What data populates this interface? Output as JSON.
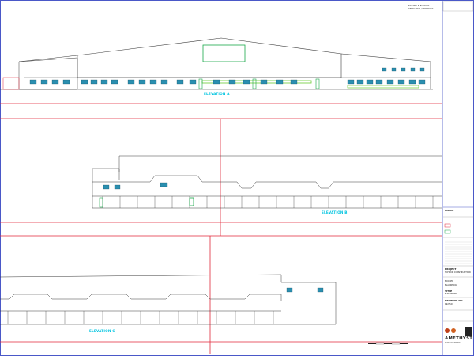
{
  "drawing": {
    "elevations": [
      {
        "id": "elevation-a",
        "label": "ELEVATION A"
      },
      {
        "id": "elevation-b",
        "label": "ELEVATION B"
      },
      {
        "id": "elevation-c",
        "label": "ELEVATION C"
      }
    ],
    "legend_notes": [
      "EXISTING ELEVATIONS",
      "DEMOLITION / NEW WORK"
    ],
    "colors": {
      "building_line": "#3a3a3a",
      "grid_red": "#e0283a",
      "window_fill": "#2a8fb0",
      "door_green": "#1aa84a",
      "highlight_green": "#7ad14a",
      "label_cyan": "#00c4e0",
      "border_blue": "#4a58c8"
    }
  },
  "title_block": {
    "client_label": "CLIENT",
    "project_label": "PROJECT",
    "project_line1": "SCHOOL CONSTRUCTION",
    "site_line1": "BOOKER",
    "site_line2": "BLACKPOOL",
    "drawing_title_label": "TITLE",
    "drawing_title": "ELEVATIONS",
    "drawing_no_label": "DRAWING NO.",
    "drawing_no": "1925-01",
    "brand_name": "AMETHYST",
    "brand_sub": "SURVEYS LIMITED"
  }
}
